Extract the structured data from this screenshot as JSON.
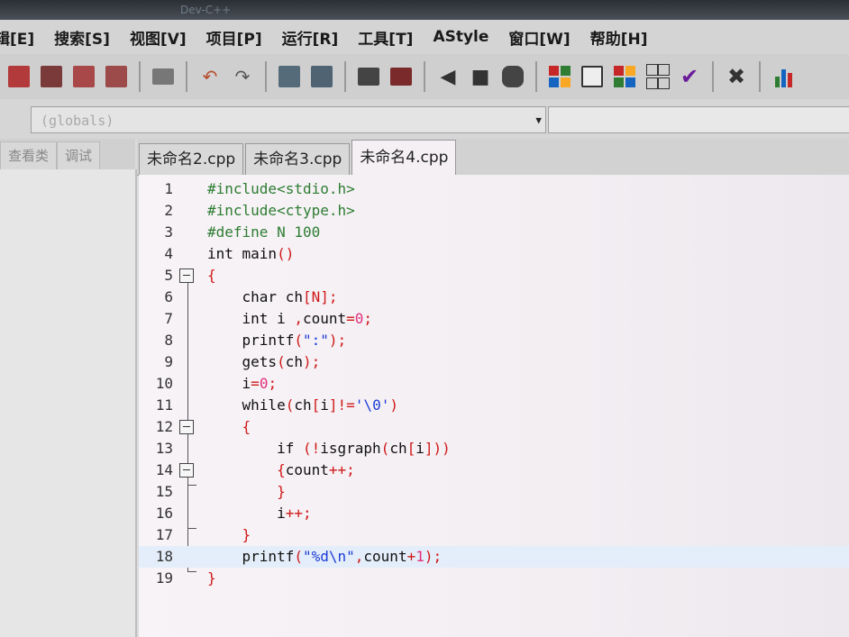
{
  "window": {
    "title": "Dev-C++"
  },
  "menu": [
    "辑[E]",
    "搜索[S]",
    "视图[V]",
    "项目[P]",
    "运行[R]",
    "工具[T]",
    "AStyle",
    "窗口[W]",
    "帮助[H]"
  ],
  "toolbar": {
    "buttons": [
      "new-file-icon",
      "save-icon",
      "save-all-icon",
      "close-file-icon",
      "print-icon",
      "undo-icon",
      "redo-icon",
      "find-icon",
      "replace-icon",
      "indent-icon",
      "unindent-icon",
      "bookmark-prev-icon",
      "bookmark-next-icon",
      "goto-icon",
      "compile-icon",
      "run-icon",
      "compile-run-icon",
      "rebuild-icon",
      "check-icon",
      "stop-icon",
      "chart-icon"
    ],
    "colors": {
      "grid_red": "#c62828",
      "grid_green": "#2e7d32",
      "grid_blue": "#1565c0",
      "grid_yellow": "#f9a825",
      "check": "#6a1b9a",
      "stop": "#333333"
    }
  },
  "scope_combo": {
    "value": "(globals)"
  },
  "left_panel": {
    "tabs": [
      "查看类",
      "调试"
    ]
  },
  "editor": {
    "tabs": [
      "未命名2.cpp",
      "未命名3.cpp",
      "未命名4.cpp"
    ],
    "active_tab": 2,
    "highlighted_line": 18,
    "lines": [
      {
        "n": "1",
        "tokens": [
          [
            "pp",
            "#include<stdio.h>"
          ]
        ]
      },
      {
        "n": "2",
        "tokens": [
          [
            "pp",
            "#include<ctype.h>"
          ]
        ]
      },
      {
        "n": "3",
        "tokens": [
          [
            "pp",
            "#define N 100"
          ]
        ]
      },
      {
        "n": "4",
        "tokens": [
          [
            "tx",
            "int main"
          ],
          [
            "pu",
            "()"
          ]
        ]
      },
      {
        "n": "5",
        "tokens": [
          [
            "pu",
            "{"
          ]
        ]
      },
      {
        "n": "6",
        "tokens": [
          [
            "tx",
            "    char ch"
          ],
          [
            "pu",
            "[N];"
          ]
        ]
      },
      {
        "n": "7",
        "tokens": [
          [
            "tx",
            "    int i "
          ],
          [
            "pu",
            ","
          ],
          [
            "tx",
            "count"
          ],
          [
            "pu",
            "="
          ],
          [
            "num",
            "0"
          ],
          [
            "pu",
            ";"
          ]
        ]
      },
      {
        "n": "8",
        "tokens": [
          [
            "tx",
            "    printf"
          ],
          [
            "pu",
            "("
          ],
          [
            "str",
            "\":\""
          ],
          [
            "pu",
            ");"
          ]
        ]
      },
      {
        "n": "9",
        "tokens": [
          [
            "tx",
            "    gets"
          ],
          [
            "pu",
            "("
          ],
          [
            "tx",
            "ch"
          ],
          [
            "pu",
            ");"
          ]
        ]
      },
      {
        "n": "10",
        "tokens": [
          [
            "tx",
            "    i"
          ],
          [
            "pu",
            "="
          ],
          [
            "num",
            "0"
          ],
          [
            "pu",
            ";"
          ]
        ]
      },
      {
        "n": "11",
        "tokens": [
          [
            "tx",
            "    while"
          ],
          [
            "pu",
            "("
          ],
          [
            "tx",
            "ch"
          ],
          [
            "pu",
            "["
          ],
          [
            "tx",
            "i"
          ],
          [
            "pu",
            "]!="
          ],
          [
            "str",
            "'\\0'"
          ],
          [
            "pu",
            ")"
          ]
        ]
      },
      {
        "n": "12",
        "tokens": [
          [
            "pu",
            "    {"
          ]
        ]
      },
      {
        "n": "13",
        "tokens": [
          [
            "tx",
            "        if "
          ],
          [
            "pu",
            "(!"
          ],
          [
            "tx",
            "isgraph"
          ],
          [
            "pu",
            "("
          ],
          [
            "tx",
            "ch"
          ],
          [
            "pu",
            "["
          ],
          [
            "tx",
            "i"
          ],
          [
            "pu",
            "]))"
          ]
        ]
      },
      {
        "n": "14",
        "tokens": [
          [
            "pu",
            "        {"
          ],
          [
            "tx",
            "count"
          ],
          [
            "pu",
            "++;"
          ]
        ]
      },
      {
        "n": "15",
        "tokens": [
          [
            "pu",
            "        }"
          ]
        ]
      },
      {
        "n": "16",
        "tokens": [
          [
            "tx",
            "        i"
          ],
          [
            "pu",
            "++;"
          ]
        ]
      },
      {
        "n": "17",
        "tokens": [
          [
            "pu",
            "    }"
          ]
        ]
      },
      {
        "n": "18",
        "tokens": [
          [
            "tx",
            "    printf"
          ],
          [
            "pu",
            "("
          ],
          [
            "str",
            "\"%d\\n\""
          ],
          [
            "pu",
            ","
          ],
          [
            "tx",
            "count"
          ],
          [
            "pu",
            "+"
          ],
          [
            "num",
            "1"
          ],
          [
            "pu",
            ");"
          ]
        ]
      },
      {
        "n": "19",
        "tokens": [
          [
            "pu",
            "}"
          ]
        ]
      }
    ],
    "colors": {
      "preprocessor": "#2e7d32",
      "text": "#111111",
      "punct": "#d01818",
      "number": "#e0307a",
      "string": "#1c3bd6",
      "highlight": "#e4eefa"
    }
  }
}
